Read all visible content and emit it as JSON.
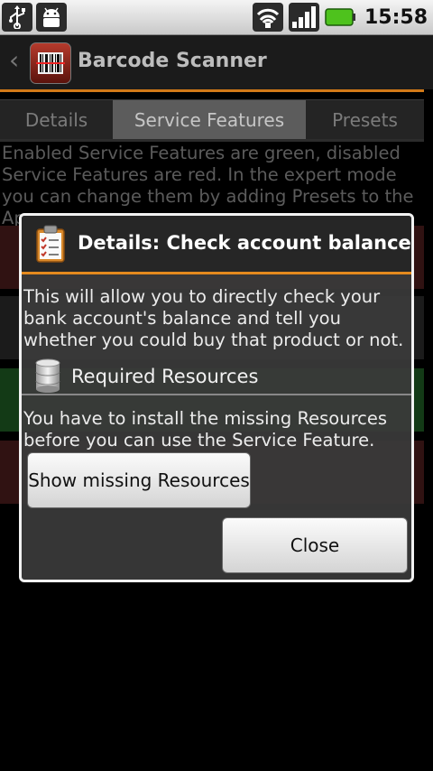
{
  "status_bar": {
    "time": "15:58",
    "left_icons": [
      "usb-icon",
      "android-debug-icon"
    ],
    "right_icons": [
      "wifi-icon",
      "signal-icon",
      "battery-icon"
    ]
  },
  "app": {
    "title": "Barcode Scanner"
  },
  "tabs": [
    {
      "label": "Details",
      "active": false
    },
    {
      "label": "Service Features",
      "active": true
    },
    {
      "label": "Presets",
      "active": false
    }
  ],
  "intro_text": "Enabled Service Features are green, disabled Service Features are red. In the expert mode you can change them by adding Presets to the App.",
  "dialog": {
    "title": "Details: Check account balance",
    "description": "This will allow you to directly check your bank account's balance and tell you whether you could buy that product or not.",
    "resources_title": "Required Resources",
    "resources_text": "You have to install the missing Resources before you can use the Service Feature.",
    "show_missing_label": "Show missing Resources",
    "close_label": "Close"
  },
  "colors": {
    "accent_orange": "#e58a1e",
    "enabled_green": "#1e5a22",
    "disabled_red": "#4b1c1c"
  }
}
